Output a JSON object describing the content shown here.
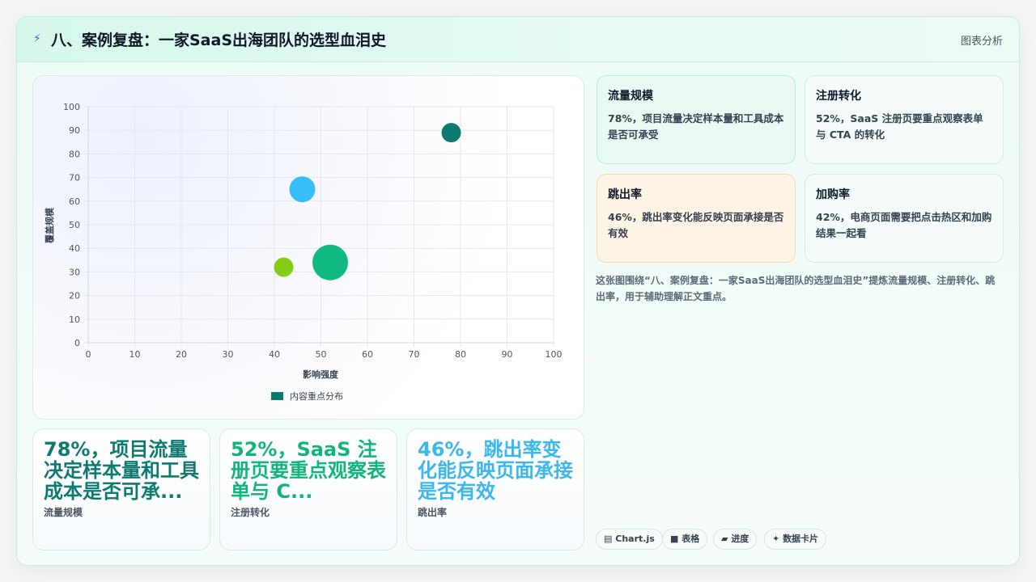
{
  "header": {
    "title": "八、案例复盘：一家SaaS出海团队的选型血泪史",
    "action": "图表分析"
  },
  "chart_data": {
    "type": "bubble",
    "title": "",
    "xlabel": "影响强度",
    "ylabel": "覆盖规模",
    "xlim": [
      0,
      100
    ],
    "ylim": [
      0,
      100
    ],
    "xticks": [
      0,
      10,
      20,
      30,
      40,
      50,
      60,
      70,
      80,
      90,
      100
    ],
    "yticks": [
      0,
      10,
      20,
      30,
      40,
      50,
      60,
      70,
      80,
      90,
      100
    ],
    "grid": true,
    "legend_position": "bottom",
    "series": [
      {
        "name": "内容重点分布",
        "points": [
          {
            "x": 78,
            "y": 89,
            "r": 12,
            "color": "#0e7a6f"
          },
          {
            "x": 46,
            "y": 65,
            "r": 16,
            "color": "#38bdf8"
          },
          {
            "x": 42,
            "y": 32,
            "r": 12,
            "color": "#84cc16"
          },
          {
            "x": 52,
            "y": 34,
            "r": 22,
            "color": "#10b981"
          }
        ]
      }
    ]
  },
  "metrics": [
    {
      "title": "流量规模",
      "desc": "78%，项目流量决定样本量和工具成本是否可承受"
    },
    {
      "title": "注册转化",
      "desc": "52%，SaaS 注册页要重点观察表单与 CTA 的转化"
    },
    {
      "title": "跳出率",
      "desc": "46%，跳出率变化能反映页面承接是否有效"
    },
    {
      "title": "加购率",
      "desc": "42%，电商页面需要把点击热区和加购结果一起看"
    }
  ],
  "note": "这张图围绕“八、案例复盘：一家SaaS出海团队的选型血泪史”提炼流量规模、注册转化、跳出率，用于辅助理解正文重点。",
  "tags": [
    {
      "icon": "▤",
      "label": "Chart.js"
    },
    {
      "icon": "■",
      "label": "表格"
    },
    {
      "icon": "▰",
      "label": "进度"
    },
    {
      "icon": "✦",
      "label": "数据卡片"
    }
  ],
  "big_cards": [
    {
      "value": "78%，项目流量决定样本量和工具成本是否可承...",
      "label": "流量规模"
    },
    {
      "value": "52%，SaaS 注册页要重点观察表单与 C...",
      "label": "注册转化"
    },
    {
      "value": "46%，跳出率变化能反映页面承接是否有效",
      "label": "跳出率"
    }
  ],
  "colors": {
    "accent_dark": "#0e7a6f",
    "accent_green": "#10b981",
    "accent_blue": "#38bdf8",
    "accent_lime": "#84cc16"
  }
}
